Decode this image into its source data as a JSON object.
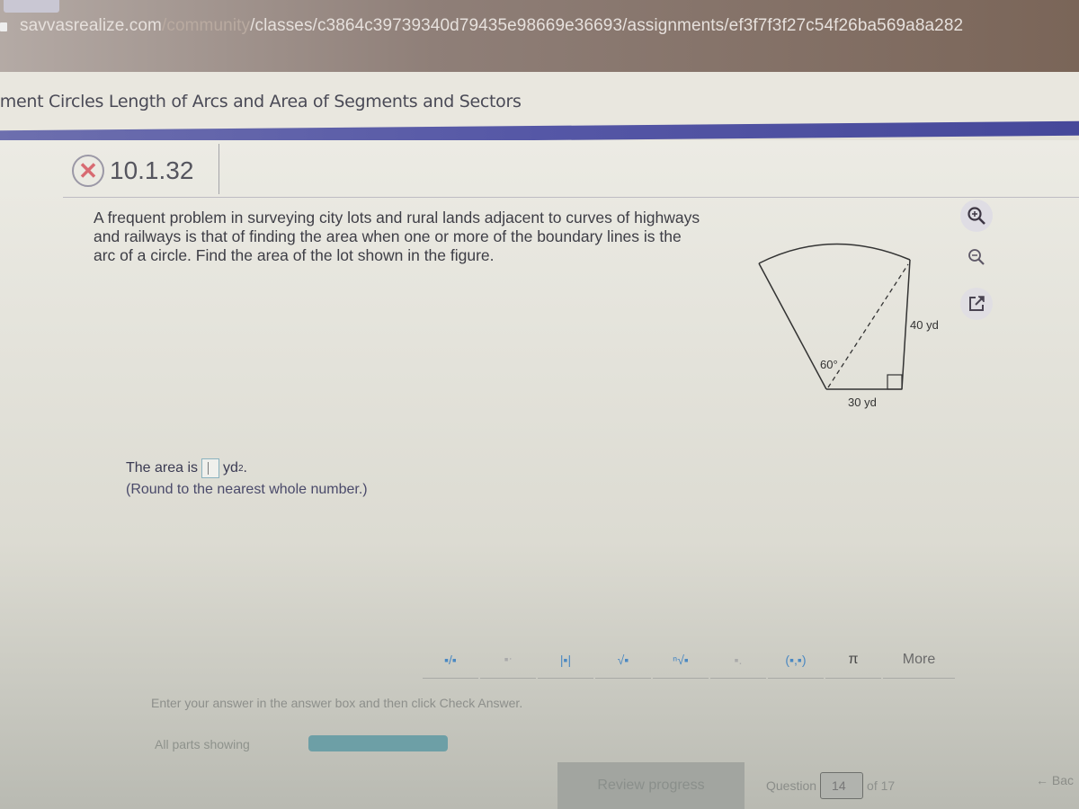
{
  "browser": {
    "url_domain": "savvasrealize.com",
    "url_path_dim": "/community",
    "url_path": "/classes/c3864c39739340d79435e98669e36693/assignments/ef3f7f3f27c54f26ba569a8a282"
  },
  "header": {
    "title": "nment Circles Length of Arcs and Area of Segments and Sectors"
  },
  "question": {
    "number": "10.1.32",
    "status_icon": "incorrect-x-icon",
    "text": "A frequent problem in surveying city lots and rural lands adjacent to curves of highways and railways is that of finding the area when one or more of the boundary lines is the arc of a circle. Find the area of the lot shown in the figure."
  },
  "figure": {
    "angle_label": "60°",
    "side_label": "40 yd",
    "base_label": "30 yd"
  },
  "tools": [
    {
      "name": "zoom-in",
      "icon": "zoom-in-icon"
    },
    {
      "name": "zoom-out",
      "icon": "zoom-out-icon"
    },
    {
      "name": "popout",
      "icon": "popout-icon"
    }
  ],
  "answer": {
    "prefix": "The area is",
    "value": "",
    "unit": "yd",
    "unit_exp": "2",
    "suffix": ".",
    "instruction": "(Round to the nearest whole number.)"
  },
  "math_toolbar": {
    "buttons": [
      {
        "name": "fraction",
        "symbol": "▪/▪"
      },
      {
        "name": "exponent",
        "symbol": "▪ᐧ"
      },
      {
        "name": "absolute-value",
        "symbol": "|▪|"
      },
      {
        "name": "square-root",
        "symbol": "√▪"
      },
      {
        "name": "nth-root",
        "symbol": "ⁿ√▪"
      },
      {
        "name": "subscript",
        "symbol": "▪."
      },
      {
        "name": "ordered-pair",
        "symbol": "(▪,▪)"
      },
      {
        "name": "pi",
        "symbol": "π"
      },
      {
        "name": "more",
        "symbol": "More"
      }
    ]
  },
  "hint": "Enter your answer in the answer box and then click Check Answer.",
  "parts": {
    "label": "All parts showing"
  },
  "footer": {
    "review_label": "Review progress",
    "question_label": "Question",
    "question_value": "14",
    "of_label": "of 17",
    "back_label": "← Bac"
  }
}
